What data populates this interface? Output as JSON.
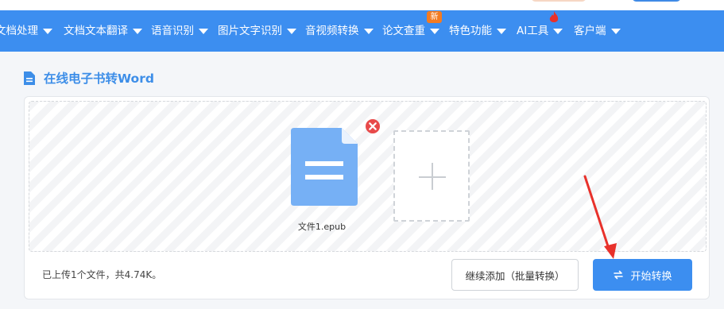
{
  "nav": {
    "items": [
      {
        "label": "文档处理"
      },
      {
        "label": "文档文本翻译"
      },
      {
        "label": "语音识别"
      },
      {
        "label": "图片文字识别"
      },
      {
        "label": "音视频转换"
      },
      {
        "label": "论文查重"
      },
      {
        "label": "特色功能"
      },
      {
        "label": "AI工具"
      },
      {
        "label": "客户端"
      }
    ],
    "new_badge": "新"
  },
  "page": {
    "title": "在线电子书转Word"
  },
  "upload": {
    "file_name": "文件1.epub",
    "status": "已上传1个文件，共4.74K。"
  },
  "actions": {
    "add_more_label": "继续添加（批量转换）",
    "start_label": "开始转换"
  },
  "colors": {
    "primary": "#3c8ef0",
    "title": "#3d8ee8",
    "file_icon": "#76b0f5",
    "remove": "#e84a4a",
    "badge": "#f37b22",
    "annotation_arrow": "#e8312b"
  },
  "icons": {
    "section": "document-icon",
    "file": "file-icon",
    "remove": "close-circle-icon",
    "add": "plus-icon",
    "start": "swap-arrows-icon",
    "nav_caret": "caret-down-icon",
    "hot": "fire-icon"
  }
}
